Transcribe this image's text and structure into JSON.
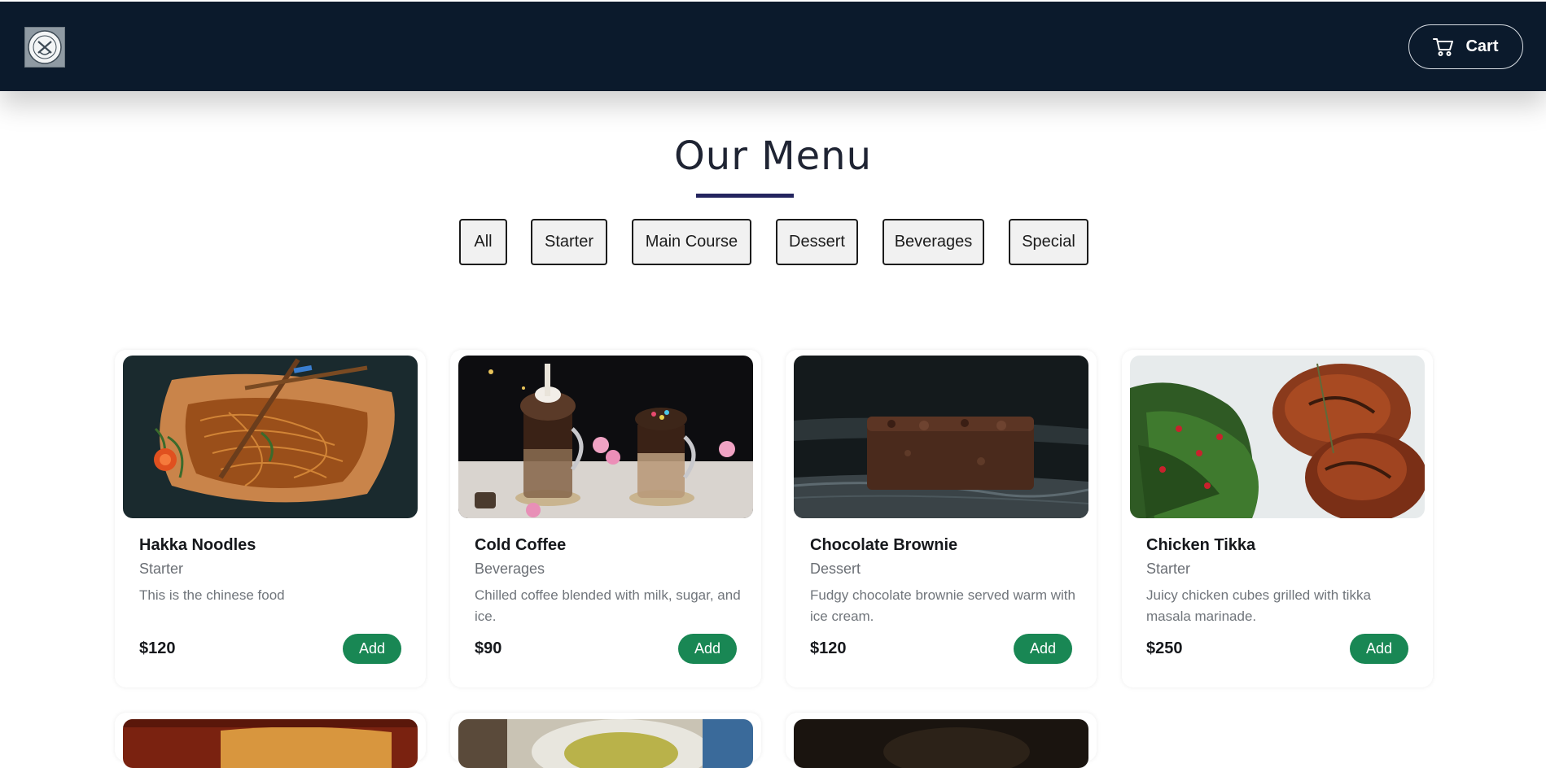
{
  "navbar": {
    "logo_alt": "restaurant-logo",
    "cart_label": "Cart"
  },
  "menu": {
    "title": "Our Menu",
    "filters": [
      "All",
      "Starter",
      "Main Course",
      "Dessert",
      "Beverages",
      "Special"
    ]
  },
  "items": [
    {
      "name": "Hakka Noodles",
      "category": "Starter",
      "description": "This is the chinese food",
      "price": "$120",
      "add_label": "Add"
    },
    {
      "name": "Cold Coffee",
      "category": "Beverages",
      "description": "Chilled coffee blended with milk, sugar, and ice.",
      "price": "$90",
      "add_label": "Add"
    },
    {
      "name": "Chocolate Brownie",
      "category": "Dessert",
      "description": "Fudgy chocolate brownie served warm with ice cream.",
      "price": "$120",
      "add_label": "Add"
    },
    {
      "name": "Chicken Tikka",
      "category": "Starter",
      "description": "Juicy chicken cubes grilled with tikka masala marinade.",
      "price": "$250",
      "add_label": "Add"
    }
  ],
  "colors": {
    "navbar": "#0b1a2c",
    "accent_underline": "#23245e",
    "add_button": "#198754"
  },
  "icons": {
    "cart": "cart-icon"
  }
}
